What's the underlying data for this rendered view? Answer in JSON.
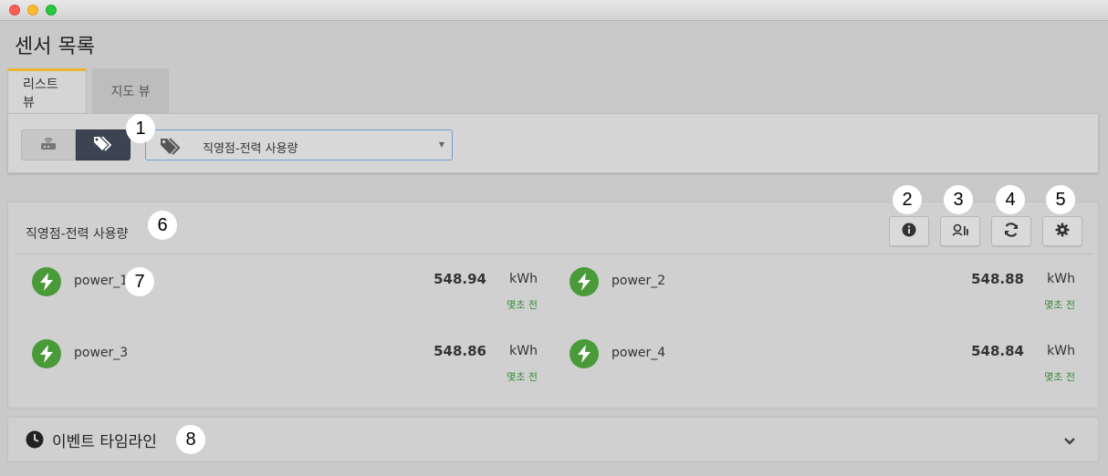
{
  "window": {
    "title": ""
  },
  "page": {
    "title": "센서 목록"
  },
  "tabs": [
    {
      "label": "리스트 뷰",
      "active": true
    },
    {
      "label": "지도 뷰",
      "active": false
    }
  ],
  "filter": {
    "selected_group": "직영점-전력 사용량",
    "left_toggle_icon": "router-icon",
    "right_toggle_icon": "tags-icon"
  },
  "group": {
    "title": "직영점-전력 사용량",
    "tools": [
      {
        "icon": "info-icon"
      },
      {
        "icon": "sensor-chart-icon"
      },
      {
        "icon": "refresh-icon"
      },
      {
        "icon": "gear-icon"
      }
    ]
  },
  "sensors": [
    {
      "name": "power_1",
      "value": "548.94",
      "unit": "kWh",
      "time": "몇초 전",
      "icon": "bolt-icon"
    },
    {
      "name": "power_2",
      "value": "548.88",
      "unit": "kWh",
      "time": "몇초 전",
      "icon": "bolt-icon"
    },
    {
      "name": "power_3",
      "value": "548.86",
      "unit": "kWh",
      "time": "몇초 전",
      "icon": "bolt-icon"
    },
    {
      "name": "power_4",
      "value": "548.84",
      "unit": "kWh",
      "time": "몇초 전",
      "icon": "bolt-icon"
    }
  ],
  "timeline": {
    "title": "이벤트 타임라인"
  },
  "callouts": [
    "1",
    "2",
    "3",
    "4",
    "5",
    "6",
    "7",
    "8"
  ],
  "colors": {
    "accent_tab": "#e8b730",
    "status_green": "#3b8b3b",
    "bolt_green": "#4a9a3a",
    "dark_toggle": "#3c4452"
  }
}
